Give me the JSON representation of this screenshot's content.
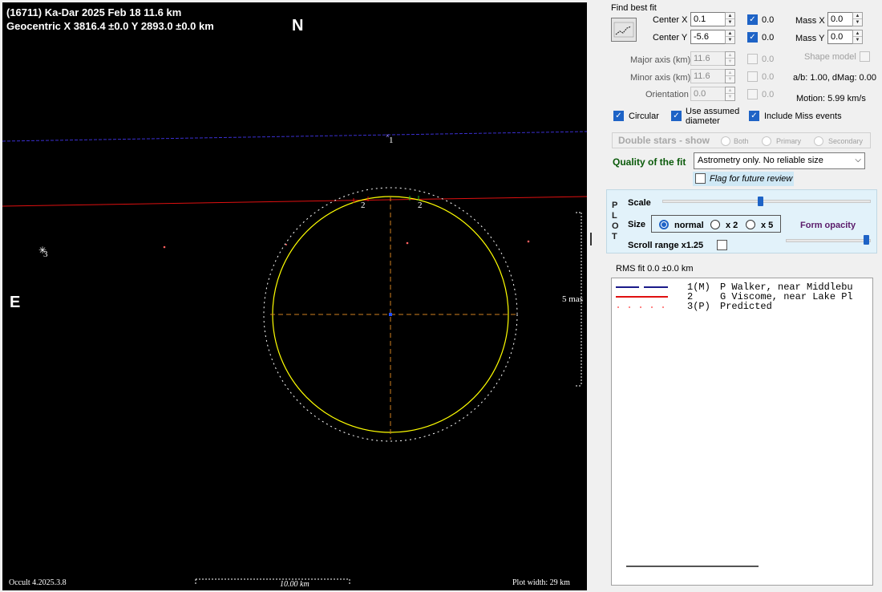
{
  "plot": {
    "header_line1": "(16711) Ka-Dar  2025 Feb 18   11.6 km",
    "header_line2": "Geocentric  X  3816.4 ±0.0  Y 2893.0 ±0.0 km",
    "north_label": "N",
    "east_label": "E",
    "chord_labels": [
      "1",
      "2",
      "2",
      "3"
    ],
    "scale_vertical_label": "5 mas",
    "scale_horizontal_label": "10.00 km",
    "version": "Occult 4.2025.3.8",
    "plot_width": "Plot width: 29 km",
    "colors": {
      "background": "#000000",
      "ellipse": "#ffff00",
      "axes": "#d08020",
      "chord1": "#3a2fd0",
      "chord2": "#e01010",
      "predicted": "#ff6060",
      "center": "#2050ff"
    }
  },
  "fit": {
    "find_best_fit_label": "Find best fit",
    "find_best_fit_icon": "chart-line-icon",
    "center_x": {
      "label": "Center X",
      "value": "0.1",
      "checked": true,
      "uncert": "0.0"
    },
    "center_y": {
      "label": "Center Y",
      "value": "-5.6",
      "checked": true,
      "uncert": "0.0"
    },
    "mass_x": {
      "label": "Mass X",
      "value": "0.0"
    },
    "mass_y": {
      "label": "Mass Y",
      "value": "0.0"
    },
    "major_axis": {
      "label": "Major axis (km)",
      "value": "11.6",
      "uncert": "0.0"
    },
    "minor_axis": {
      "label": "Minor axis (km)",
      "value": "11.6",
      "uncert": "0.0"
    },
    "orientation": {
      "label": "Orientation",
      "value": "0.0",
      "uncert": "0.0"
    },
    "shape_model": "Shape model",
    "ab_dmag": "a/b: 1.00, dMag: 0.00",
    "motion": "Motion: 5.99 km/s",
    "circular": "Circular",
    "use_assumed_diameter": "Use assumed diameter",
    "include_miss_events": "Include Miss events",
    "double_stars": "Double stars - show",
    "both": "Both",
    "primary": "Primary",
    "secondary": "Secondary",
    "quality_label": "Quality of the fit",
    "quality_value": "Astrometry only. No reliable size",
    "flag_future_review": "Flag for future review"
  },
  "plot_panel": {
    "title": "PLOT",
    "scale": "Scale",
    "scale_level": 0.47,
    "size": "Size",
    "size_normal": "normal",
    "size_x2": "x 2",
    "size_x5": "x 5",
    "form_opacity": "Form opacity",
    "form_opacity_level": 0.98,
    "scroll_range": "Scroll range x1.25"
  },
  "rms_fit": "RMS fit 0.0 ±0.0 km",
  "legend": [
    {
      "num": "1(M)",
      "text": "P Walker, near Middlebu",
      "color": "#1a1a8a",
      "style": "dash"
    },
    {
      "num": "2",
      "text": "G Viscome, near Lake Pl",
      "color": "#e01010",
      "style": "solid"
    },
    {
      "num": "3(P)",
      "text": "Predicted",
      "color": "#ff6060",
      "style": "dots"
    }
  ]
}
